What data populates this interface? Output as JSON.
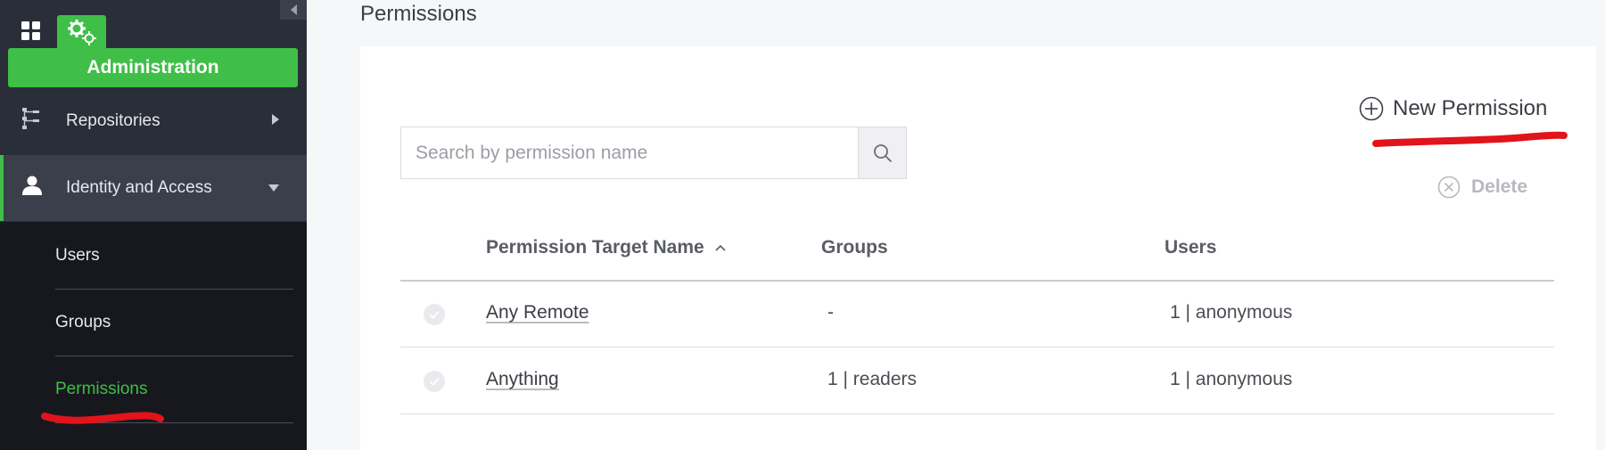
{
  "sidebar": {
    "section_title": "Administration",
    "nav": [
      {
        "label": "Repositories",
        "icon": "repositories-tree-icon"
      },
      {
        "label": "Identity and Access",
        "icon": "user-icon"
      }
    ],
    "sub_items": [
      {
        "label": "Users"
      },
      {
        "label": "Groups"
      },
      {
        "label": "Permissions",
        "active": true
      }
    ]
  },
  "page": {
    "title": "Permissions"
  },
  "toolbar": {
    "search_placeholder": "Search by permission name",
    "search_value": "",
    "new_permission_label": "New Permission",
    "delete_label": "Delete"
  },
  "table": {
    "columns": [
      "Permission Target Name",
      "Groups",
      "Users"
    ],
    "sort": {
      "column": "Permission Target Name",
      "direction": "ascending"
    },
    "rows": [
      {
        "name": "Any Remote",
        "groups": "-",
        "users": "1 | anonymous"
      },
      {
        "name": "Anything",
        "groups": "1 | readers",
        "users": "1 | anonymous"
      }
    ]
  },
  "colors": {
    "accent": "#3fbf47",
    "sidebar": "#2a2e38",
    "sidebar_dark": "#17181e",
    "annotation": "#e0141a"
  }
}
